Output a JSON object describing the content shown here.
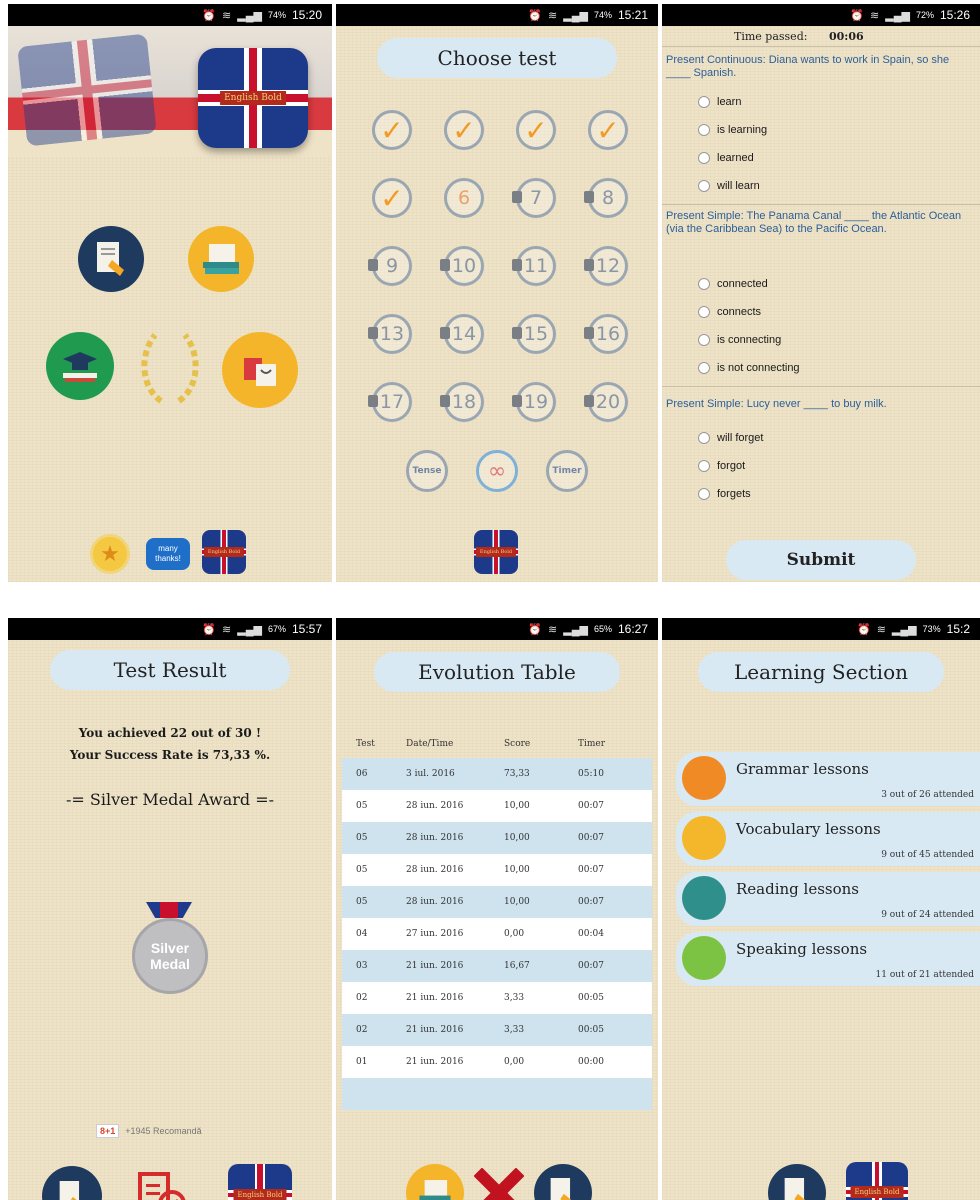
{
  "statusbars": {
    "s1": "15:20",
    "s1_batt": "74%",
    "s2": "15:21",
    "s2_batt": "74%",
    "s3": "15:26",
    "s3_batt": "72%",
    "s4": "15:57",
    "s4_batt": "67%",
    "s5": "16:27",
    "s5_batt": "65%",
    "s6": "15:2",
    "s6_batt": "73%"
  },
  "home": {
    "logo_text": "English Bold",
    "icons": [
      "tests-icon",
      "lessons-icon",
      "graduation-icon",
      "laurel-icon",
      "shop-icon"
    ],
    "bottom": {
      "thanks_label": "many thanks!",
      "flag_text": "English Bold"
    }
  },
  "choose": {
    "title": "Choose test",
    "tests": [
      {
        "label": "✓",
        "state": "done"
      },
      {
        "label": "✓",
        "state": "done"
      },
      {
        "label": "✓",
        "state": "done"
      },
      {
        "label": "✓",
        "state": "done"
      },
      {
        "label": "✓",
        "state": "done"
      },
      {
        "label": "6",
        "state": "open"
      },
      {
        "label": "7",
        "state": "locked"
      },
      {
        "label": "8",
        "state": "locked"
      },
      {
        "label": "9",
        "state": "locked"
      },
      {
        "label": "10",
        "state": "locked"
      },
      {
        "label": "11",
        "state": "locked"
      },
      {
        "label": "12",
        "state": "locked"
      },
      {
        "label": "13",
        "state": "locked"
      },
      {
        "label": "14",
        "state": "locked"
      },
      {
        "label": "15",
        "state": "locked"
      },
      {
        "label": "16",
        "state": "locked"
      },
      {
        "label": "17",
        "state": "locked"
      },
      {
        "label": "18",
        "state": "locked"
      },
      {
        "label": "19",
        "state": "locked"
      },
      {
        "label": "20",
        "state": "locked"
      }
    ],
    "modes": [
      "Tense",
      "∞",
      "Timer"
    ],
    "flag_text": "English Bold"
  },
  "quiz": {
    "time_label": "Time passed:",
    "time_value": "00:06",
    "questions": [
      {
        "text": "Present Continuous: Diana wants to work in Spain, so she ____ Spanish.",
        "options": [
          "learn",
          "is learning",
          "learned",
          "will learn"
        ]
      },
      {
        "text": "Present Simple: The Panama Canal ____ the Atlantic Ocean (via the Caribbean Sea) to the Pacific Ocean.",
        "options": [
          "connected",
          "connects",
          "is connecting",
          "is not connecting"
        ]
      },
      {
        "text": "Present Simple: Lucy never ____ to buy milk.",
        "options": [
          "will forget",
          "forgot",
          "forgets"
        ]
      }
    ],
    "submit_label": "Submit"
  },
  "result": {
    "title": "Test Result",
    "line1": "You achieved 22 out of 30 !",
    "line2": "Your Success Rate is 73,33 %.",
    "award": "-= Silver Medal Award =-",
    "medal_line1": "Silver",
    "medal_line2": "Medal",
    "gplus_label": "8+1",
    "gplus_text": "+1945 Recomandă",
    "flag_text": "English Bold"
  },
  "evolution": {
    "title": "Evolution Table",
    "headers": [
      "Test",
      "Date/Time",
      "Score",
      "Timer"
    ],
    "rows": [
      [
        "06",
        "3 iul. 2016",
        "73,33",
        "05:10"
      ],
      [
        "05",
        "28 iun. 2016",
        "10,00",
        "00:07"
      ],
      [
        "05",
        "28 iun. 2016",
        "10,00",
        "00:07"
      ],
      [
        "05",
        "28 iun. 2016",
        "10,00",
        "00:07"
      ],
      [
        "05",
        "28 iun. 2016",
        "10,00",
        "00:07"
      ],
      [
        "04",
        "27 iun. 2016",
        "0,00",
        "00:04"
      ],
      [
        "03",
        "21 iun. 2016",
        "16,67",
        "00:07"
      ],
      [
        "02",
        "21 iun. 2016",
        "3,33",
        "00:05"
      ],
      [
        "02",
        "21 iun. 2016",
        "3,33",
        "00:05"
      ],
      [
        "01",
        "21 iun. 2016",
        "0,00",
        "00:00"
      ]
    ]
  },
  "learning": {
    "title": "Learning Section",
    "items": [
      {
        "label": "Grammar lessons",
        "sub": "3 out of 26 attended",
        "color": "#f08a24"
      },
      {
        "label": "Vocabulary lessons",
        "sub": "9 out of 45 attended",
        "color": "#f4b62a"
      },
      {
        "label": "Reading lessons",
        "sub": "9 out of 24 attended",
        "color": "#2f8f8a"
      },
      {
        "label": "Speaking lessons",
        "sub": "11 out of 21 attended",
        "color": "#7cc243"
      }
    ],
    "flag_text": "English Bold"
  },
  "colors": {
    "navy": "#1f3a5f",
    "orange": "#f5a623",
    "green": "#27ae60",
    "red": "#d62b2b",
    "pill": "#d8e9f3"
  }
}
